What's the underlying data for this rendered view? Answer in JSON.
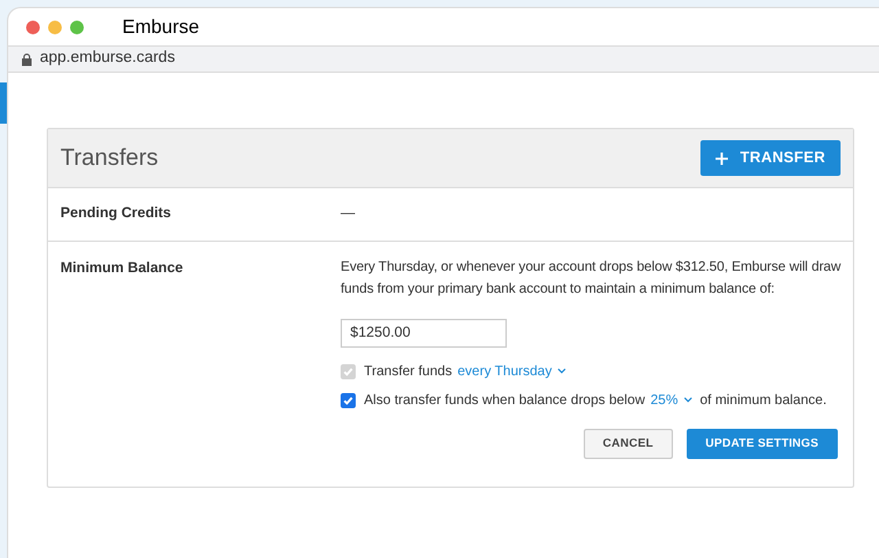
{
  "window": {
    "title": "Emburse",
    "address": "app.emburse.cards"
  },
  "panel": {
    "title": "Transfers",
    "action": "TRANSFER",
    "rows": [
      {
        "label": "Pending Credits",
        "value": "—"
      },
      {
        "label": "Minimum Balance",
        "description": "Every Thursday, or whenever your account drops below $312.50, Emburse will draw funds from your primary bank account to maintain a minimum balance of:",
        "amount": "$1250.00",
        "options": [
          {
            "text": "Transfer funds",
            "choice": "every Thursday",
            "checked": true,
            "disabled": true
          },
          {
            "text": "Also transfer funds when balance drops below",
            "choice": "25%",
            "after": "of minimum balance.",
            "checked": true,
            "disabled": false
          }
        ],
        "buttons": [
          {
            "label": "CANCEL",
            "kind": "secondary"
          },
          {
            "label": "UPDATE SETTINGS",
            "kind": "primary"
          }
        ]
      }
    ]
  }
}
